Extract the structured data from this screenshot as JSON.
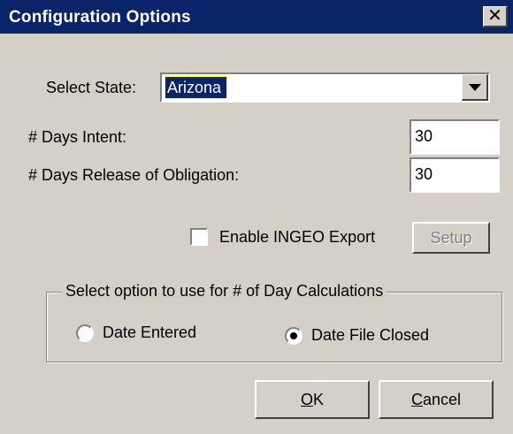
{
  "window": {
    "title": "Configuration Options",
    "close_label": "✕"
  },
  "state": {
    "label": "Select State:",
    "value": "Arizona"
  },
  "days_intent": {
    "label": "# Days Intent:",
    "value": "30"
  },
  "days_release": {
    "label": "# Days Release of Obligation:",
    "value": "30"
  },
  "ingeo": {
    "label": "Enable INGEO Export",
    "checked": false,
    "setup_label": "Setup"
  },
  "calc_group": {
    "legend": "Select option to use for # of Day Calculations",
    "options": [
      {
        "label": "Date Entered",
        "selected": false
      },
      {
        "label": "Date File Closed",
        "selected": true
      }
    ]
  },
  "buttons": {
    "ok_mnemonic": "O",
    "ok_rest": "K",
    "cancel_mnemonic": "C",
    "cancel_rest": "ancel"
  },
  "icons": [
    "close-icon",
    "dropdown-arrow-icon",
    "radio-selected-icon"
  ]
}
